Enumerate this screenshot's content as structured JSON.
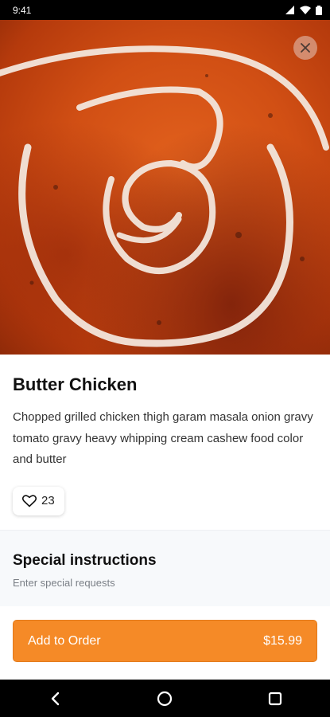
{
  "status_bar": {
    "time": "9:41"
  },
  "dish": {
    "name": "Butter Chicken",
    "description": "Chopped grilled chicken thigh garam masala onion gravy tomato gravy heavy whipping cream cashew food color and butter",
    "likes": "23"
  },
  "special_instructions": {
    "title": "Special instructions",
    "placeholder": "Enter special requests",
    "value": ""
  },
  "order_button": {
    "label": "Add to Order",
    "price": "$15.99"
  },
  "colors": {
    "accent": "#f58a27",
    "title_text": "#111111",
    "body_text": "#333333",
    "section_bg": "#f7f9fb"
  },
  "icons": {
    "close": "close-icon",
    "like": "heart-icon",
    "back": "back-nav-icon",
    "home": "home-nav-icon",
    "recents": "recents-nav-icon"
  }
}
